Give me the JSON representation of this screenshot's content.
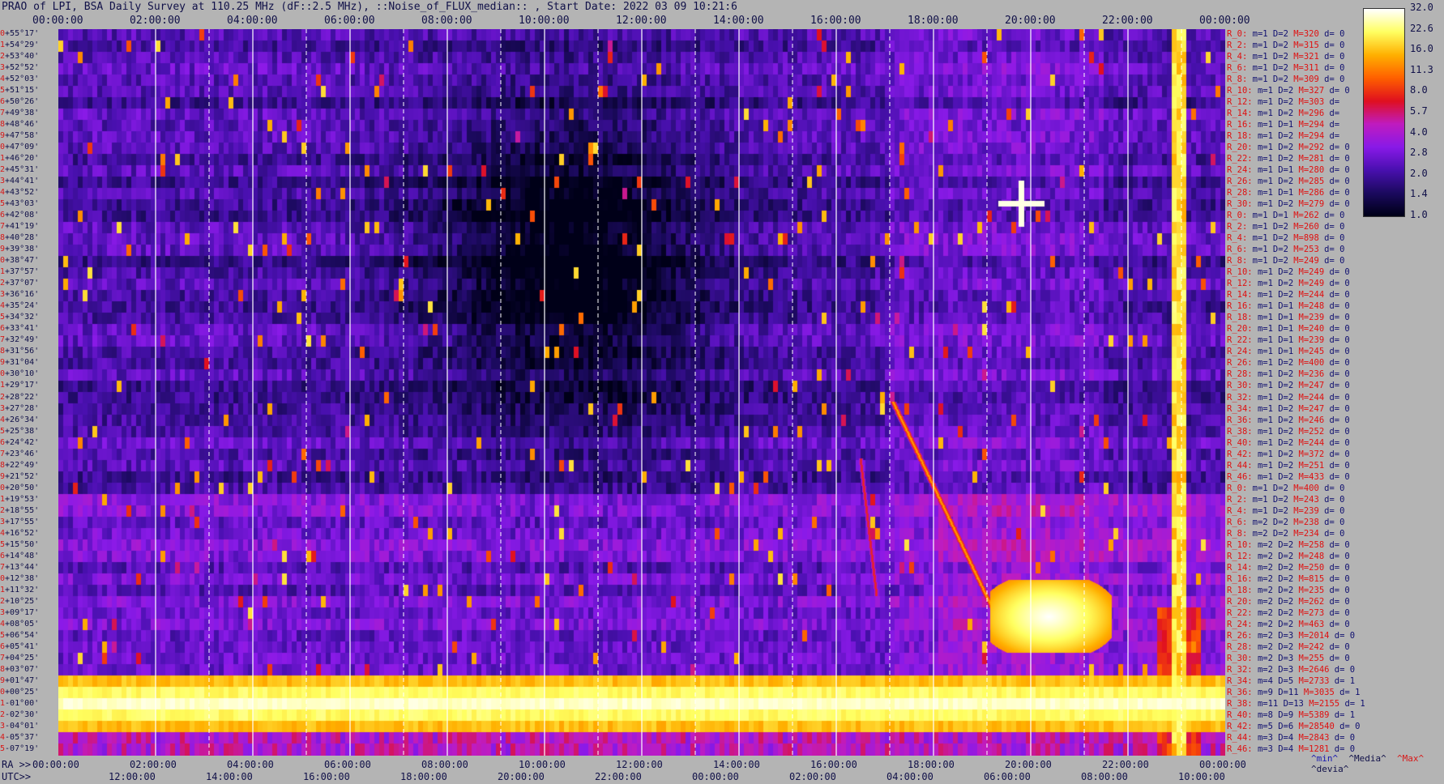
{
  "title": "PRAO of LPI, BSA Daily Survey at 110.25 MHz (dF::2.5 MHz), ::Noise_of_FLUX_median:: , Start Date: 2022 03 09 10:21:6",
  "axis": {
    "top_ticks": [
      "00:00:00",
      "02:00:00",
      "04:00:00",
      "06:00:00",
      "08:00:00",
      "10:00:00",
      "12:00:00",
      "14:00:00",
      "16:00:00",
      "18:00:00",
      "20:00:00",
      "22:00:00",
      "00:00:00"
    ],
    "ra_prefix": "RA >>",
    "ra_ticks": [
      "00:00:00",
      "02:00:00",
      "04:00:00",
      "06:00:00",
      "08:00:00",
      "10:00:00",
      "12:00:00",
      "14:00:00",
      "16:00:00",
      "18:00:00",
      "20:00:00",
      "22:00:00",
      "00:00:00"
    ],
    "utc_prefix": "UTC>>",
    "utc_ticks": [
      "12:00:00",
      "14:00:00",
      "16:00:00",
      "18:00:00",
      "20:00:00",
      "22:00:00",
      "00:00:00",
      "02:00:00",
      "04:00:00",
      "06:00:00",
      "08:00:00",
      "10:00:00"
    ]
  },
  "colorbar": {
    "ticks": [
      "32.0",
      "22.6",
      "16.0",
      "11.3",
      "8.0",
      "5.7",
      "4.0",
      "2.8",
      "2.0",
      "1.4",
      "1.0"
    ],
    "palette": [
      "#000018",
      "#1c0a60",
      "#4a10b0",
      "#8a1ae8",
      "#c01cc0",
      "#e01020",
      "#ff6000",
      "#ffb000",
      "#ffff60",
      "#ffffff"
    ]
  },
  "declinations": [
    "+55°17'",
    "+54°29'",
    "+53°40'",
    "+52°52'",
    "+52°03'",
    "+51°15'",
    "+50°26'",
    "+49°38'",
    "+48°46'",
    "+47°58'",
    "+47°09'",
    "+46°20'",
    "+45°31'",
    "+44°41'",
    "+43°52'",
    "+43°03'",
    "+42°08'",
    "+41°19'",
    "+40°28'",
    "+39°38'",
    "+38°47'",
    "+37°57'",
    "+37°07'",
    "+36°16'",
    "+35°24'",
    "+34°32'",
    "+33°41'",
    "+32°49'",
    "+31°56'",
    "+31°04'",
    "+30°10'",
    "+29°17'",
    "+28°22'",
    "+27°28'",
    "+26°34'",
    "+25°38'",
    "+24°42'",
    "+23°46'",
    "+22°49'",
    "+21°52'",
    "+20°50'",
    "+19°53'",
    "+18°55'",
    "+17°55'",
    "+16°52'",
    "+15°50'",
    "+14°48'",
    "+13°44'",
    "+12°38'",
    "+11°32'",
    "+10°25'",
    "+09°17'",
    "+08°05'",
    "+06°54'",
    "+05°41'",
    "+04°25'",
    "+03°07'",
    "+01°47'",
    "+00°25'",
    "-01°00'",
    "-02°30'",
    "-04°01'",
    "-05°37'",
    "-07°19'"
  ],
  "row_stats": [
    [
      "R_0:",
      "m=1",
      "D=2",
      "M=320",
      "d= 0"
    ],
    [
      "R_2:",
      "m=1",
      "D=2",
      "M=315",
      "d= 0"
    ],
    [
      "R_4:",
      "m=1",
      "D=2",
      "M=321",
      "d= 0"
    ],
    [
      "R_6:",
      "m=1",
      "D=2",
      "M=311",
      "d= 0"
    ],
    [
      "R_8:",
      "m=1",
      "D=2",
      "M=309",
      "d= 0"
    ],
    [
      "R_10:",
      "m=1",
      "D=2",
      "M=327",
      "d= 0"
    ],
    [
      "R_12:",
      "m=1",
      "D=2",
      "M=303",
      "d="
    ],
    [
      "R_14:",
      "m=1",
      "D=2",
      "M=296",
      "d="
    ],
    [
      "R_16:",
      "m=1",
      "D=1",
      "M=294",
      "d="
    ],
    [
      "R_18:",
      "m=1",
      "D=2",
      "M=294",
      "d="
    ],
    [
      "R_20:",
      "m=1",
      "D=2",
      "M=292",
      "d= 0"
    ],
    [
      "R_22:",
      "m=1",
      "D=2",
      "M=281",
      "d= 0"
    ],
    [
      "R_24:",
      "m=1",
      "D=1",
      "M=280",
      "d= 0"
    ],
    [
      "R_26:",
      "m=1",
      "D=2",
      "M=285",
      "d= 0"
    ],
    [
      "R_28:",
      "m=1",
      "D=1",
      "M=286",
      "d= 0"
    ],
    [
      "R_30:",
      "m=1",
      "D=2",
      "M=279",
      "d= 0"
    ],
    [
      "R_0:",
      "m=1",
      "D=1",
      "M=262",
      "d= 0"
    ],
    [
      "R_2:",
      "m=1",
      "D=2",
      "M=260",
      "d= 0"
    ],
    [
      "R_4:",
      "m=1",
      "D=2",
      "M=898",
      "d= 0"
    ],
    [
      "R_6:",
      "m=1",
      "D=2",
      "M=253",
      "d= 0"
    ],
    [
      "R_8:",
      "m=1",
      "D=2",
      "M=249",
      "d= 0"
    ],
    [
      "R_10:",
      "m=1",
      "D=2",
      "M=249",
      "d= 0"
    ],
    [
      "R_12:",
      "m=1",
      "D=2",
      "M=249",
      "d= 0"
    ],
    [
      "R_14:",
      "m=1",
      "D=2",
      "M=244",
      "d= 0"
    ],
    [
      "R_16:",
      "m=1",
      "D=1",
      "M=248",
      "d= 0"
    ],
    [
      "R_18:",
      "m=1",
      "D=1",
      "M=239",
      "d= 0"
    ],
    [
      "R_20:",
      "m=1",
      "D=1",
      "M=240",
      "d= 0"
    ],
    [
      "R_22:",
      "m=1",
      "D=1",
      "M=239",
      "d= 0"
    ],
    [
      "R_24:",
      "m=1",
      "D=1",
      "M=245",
      "d= 0"
    ],
    [
      "R_26:",
      "m=1",
      "D=2",
      "M=400",
      "d= 0"
    ],
    [
      "R_28:",
      "m=1",
      "D=2",
      "M=236",
      "d= 0"
    ],
    [
      "R_30:",
      "m=1",
      "D=2",
      "M=247",
      "d= 0"
    ],
    [
      "R_32:",
      "m=1",
      "D=2",
      "M=244",
      "d= 0"
    ],
    [
      "R_34:",
      "m=1",
      "D=2",
      "M=247",
      "d= 0"
    ],
    [
      "R_36:",
      "m=1",
      "D=2",
      "M=246",
      "d= 0"
    ],
    [
      "R_38:",
      "m=1",
      "D=2",
      "M=252",
      "d= 0"
    ],
    [
      "R_40:",
      "m=1",
      "D=2",
      "M=244",
      "d= 0"
    ],
    [
      "R_42:",
      "m=1",
      "D=2",
      "M=372",
      "d= 0"
    ],
    [
      "R_44:",
      "m=1",
      "D=2",
      "M=251",
      "d= 0"
    ],
    [
      "R_46:",
      "m=1",
      "D=2",
      "M=433",
      "d= 0"
    ],
    [
      "R_0:",
      "m=1",
      "D=2",
      "M=400",
      "d= 0"
    ],
    [
      "R_2:",
      "m=1",
      "D=2",
      "M=243",
      "d= 0"
    ],
    [
      "R_4:",
      "m=1",
      "D=2",
      "M=239",
      "d= 0"
    ],
    [
      "R_6:",
      "m=2",
      "D=2",
      "M=238",
      "d= 0"
    ],
    [
      "R_8:",
      "m=2",
      "D=2",
      "M=234",
      "d= 0"
    ],
    [
      "R_10:",
      "m=2",
      "D=2",
      "M=258",
      "d= 0"
    ],
    [
      "R_12:",
      "m=2",
      "D=2",
      "M=248",
      "d= 0"
    ],
    [
      "R_14:",
      "m=2",
      "D=2",
      "M=250",
      "d= 0"
    ],
    [
      "R_16:",
      "m=2",
      "D=2",
      "M=815",
      "d= 0"
    ],
    [
      "R_18:",
      "m=2",
      "D=2",
      "M=235",
      "d= 0"
    ],
    [
      "R_20:",
      "m=2",
      "D=2",
      "M=262",
      "d= 0"
    ],
    [
      "R_22:",
      "m=2",
      "D=2",
      "M=273",
      "d= 0"
    ],
    [
      "R_24:",
      "m=2",
      "D=2",
      "M=463",
      "d= 0"
    ],
    [
      "R_26:",
      "m=2",
      "D=3",
      "M=2014",
      "d= 0"
    ],
    [
      "R_28:",
      "m=2",
      "D=2",
      "M=242",
      "d= 0"
    ],
    [
      "R_30:",
      "m=2",
      "D=3",
      "M=255",
      "d= 0"
    ],
    [
      "R_32:",
      "m=2",
      "D=3",
      "M=2646",
      "d= 0"
    ],
    [
      "R_34:",
      "m=4",
      "D=5",
      "M=2733",
      "d= 1"
    ],
    [
      "R_36:",
      "m=9",
      "D=11",
      "M=3035",
      "d= 1"
    ],
    [
      "R_38:",
      "m=11",
      "D=13",
      "M=2155",
      "d= 1"
    ],
    [
      "R_40:",
      "m=8",
      "D=9",
      "M=5389",
      "d= 1"
    ],
    [
      "R_42:",
      "m=5",
      "D=6",
      "M=28540",
      "d= 0"
    ],
    [
      "R_44:",
      "m=3",
      "D=4",
      "M=2843",
      "d= 0"
    ],
    [
      "R_46:",
      "m=3",
      "D=4",
      "M=1281",
      "d= 0"
    ]
  ],
  "legend": {
    "min": "^min^",
    "median": "^Media^",
    "max": "^Max^",
    "devia": "^devia^"
  },
  "chart_data": {
    "type": "heatmap",
    "title": "PRAO of LPI, BSA Daily Survey at 110.25 MHz (dF::2.5 MHz), ::Noise_of_FLUX_median:: , Start Date: 2022 03 09 10:21:6",
    "x_axis": "RA 00:00:00 to 24:00:00 (UTC 10:21 start)",
    "y_axis": "Declination +55°17' to -07°19'",
    "color_scale": "log",
    "value_range": [
      1.0,
      32.0
    ],
    "n_rows": 64,
    "features": [
      {
        "label": "Galactic plane band",
        "dec_range": [
          "+01°47'",
          "-04°01'"
        ],
        "level": 20
      },
      {
        "label": "Bright source (Sun)",
        "ra_hours": 23.0,
        "level": 32
      },
      {
        "label": "Point source",
        "ra_hours": 19.8,
        "dec": "+41°19'",
        "level": 30
      }
    ]
  }
}
